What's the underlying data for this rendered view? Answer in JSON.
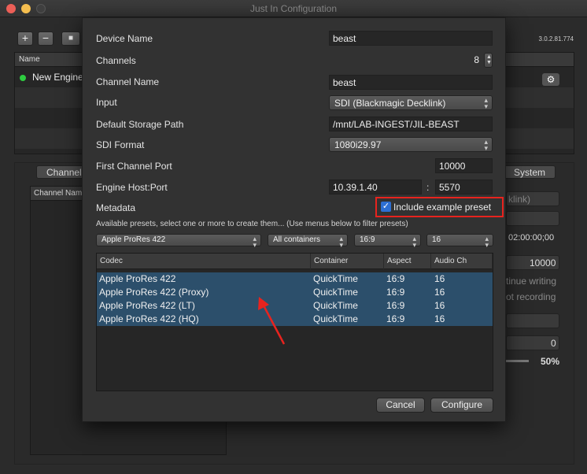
{
  "window": {
    "title": "Just In Configuration"
  },
  "toolbar": {
    "add": "+",
    "remove": "−",
    "lock": "🔒"
  },
  "version": "3.0.2.81.774",
  "engine_list": {
    "header": "Name",
    "rows": [
      {
        "name": "New Engine",
        "status": "green"
      }
    ]
  },
  "background": {
    "tab_channel": "Channel",
    "tab_system": "System",
    "channel_header": "Channel Name",
    "right_select": "klink)",
    "timecode": "02:00:00;00",
    "value_10000": "10000",
    "continue_writing": "tinue writing",
    "not_recording": "ot recording",
    "zero": "0",
    "percent": "50%"
  },
  "sheet": {
    "device_name_label": "Device Name",
    "device_name": "beast",
    "channels_label": "Channels",
    "channels": "8",
    "channel_name_label": "Channel Name",
    "channel_name": "beast",
    "input_label": "Input",
    "input": "SDI (Blackmagic Decklink)",
    "storage_label": "Default Storage Path",
    "storage": "/mnt/LAB-INGEST/JIL-BEAST",
    "sdi_format_label": "SDI Format",
    "sdi_format": "1080i29.97",
    "first_port_label": "First Channel Port",
    "first_port": "10000",
    "engine_host_label": "Engine Host:Port",
    "engine_host": "10.39.1.40",
    "engine_port": "5570",
    "colon": ":",
    "metadata_label": "Metadata",
    "include_example": "Include example preset",
    "presets_hint": "Available presets, select one or more to create them... (Use menus below to filter presets)",
    "filters": {
      "codec": "Apple ProRes 422",
      "container": "All containers",
      "aspect": "16:9",
      "audio": "16"
    },
    "table": {
      "columns": [
        "Codec",
        "Container",
        "Aspect",
        "Audio Ch"
      ],
      "rows": [
        [
          "Apple ProRes 422",
          "QuickTime",
          "16:9",
          "16"
        ],
        [
          "Apple ProRes 422 (Proxy)",
          "QuickTime",
          "16:9",
          "16"
        ],
        [
          "Apple ProRes 422 (LT)",
          "QuickTime",
          "16:9",
          "16"
        ],
        [
          "Apple ProRes 422 (HQ)",
          "QuickTime",
          "16:9",
          "16"
        ]
      ]
    },
    "cancel": "Cancel",
    "configure": "Configure"
  },
  "colors": {
    "highlight": "#e8231e",
    "selection": "#2c4f6b",
    "accent": "#2d6fd3"
  },
  "icons": {
    "gear": "gear-icon",
    "lock": "lock-icon",
    "arrow": "annotation-arrow"
  }
}
